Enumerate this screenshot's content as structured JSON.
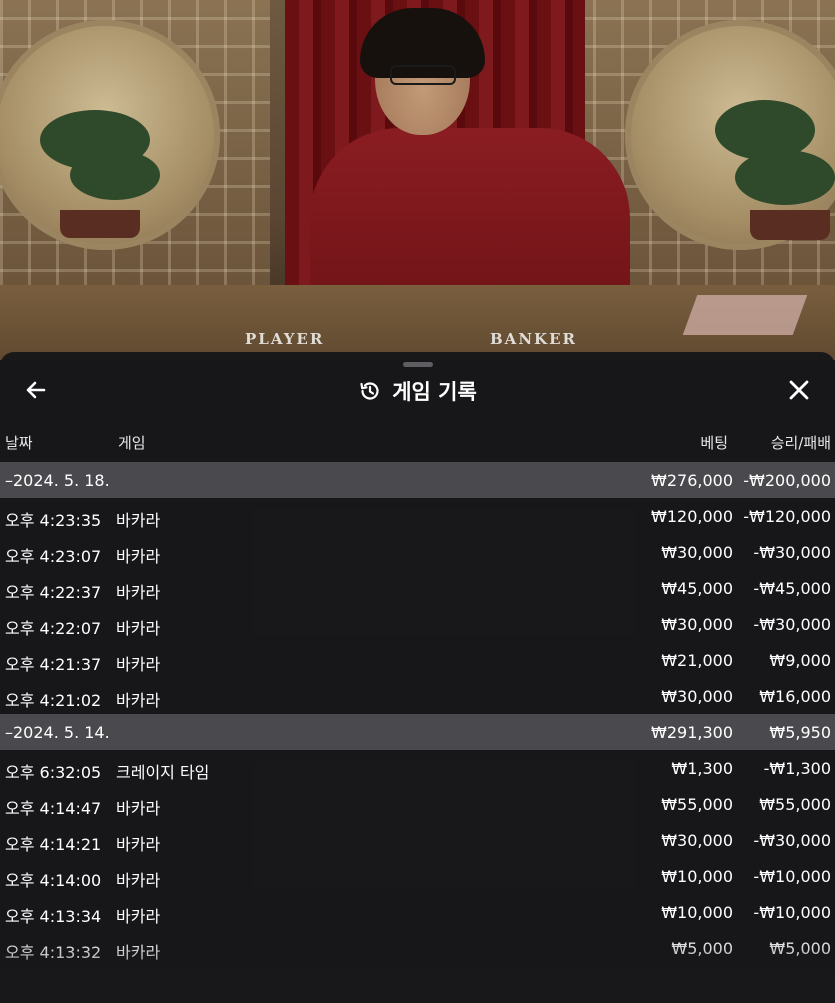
{
  "table": {
    "player_label": "PLAYER",
    "banker_label": "BANKER"
  },
  "sheet": {
    "title": "게임 기록",
    "icons": {
      "back": "arrow-left-icon",
      "history": "history-icon",
      "close": "close-icon"
    }
  },
  "columns": {
    "date": "날짜",
    "game": "게임",
    "bet": "베팅",
    "result": "승리/패배"
  },
  "groups": [
    {
      "date": "–2024. 5. 18.",
      "bet_total": "₩276,000",
      "result_total": "-₩200,000",
      "rows": [
        {
          "time": "오후 4:23:35",
          "game": "바카라",
          "bet": "₩120,000",
          "result": "-₩120,000"
        },
        {
          "time": "오후 4:23:07",
          "game": "바카라",
          "bet": "₩30,000",
          "result": "-₩30,000"
        },
        {
          "time": "오후 4:22:37",
          "game": "바카라",
          "bet": "₩45,000",
          "result": "-₩45,000"
        },
        {
          "time": "오후 4:22:07",
          "game": "바카라",
          "bet": "₩30,000",
          "result": "-₩30,000"
        },
        {
          "time": "오후 4:21:37",
          "game": "바카라",
          "bet": "₩21,000",
          "result": "₩9,000"
        },
        {
          "time": "오후 4:21:02",
          "game": "바카라",
          "bet": "₩30,000",
          "result": "₩16,000"
        }
      ]
    },
    {
      "date": "–2024. 5. 14.",
      "bet_total": "₩291,300",
      "result_total": "₩5,950",
      "rows": [
        {
          "time": "오후 6:32:05",
          "game": "크레이지 타임",
          "bet": "₩1,300",
          "result": "-₩1,300"
        },
        {
          "time": "오후 4:14:47",
          "game": "바카라",
          "bet": "₩55,000",
          "result": "₩55,000"
        },
        {
          "time": "오후 4:14:21",
          "game": "바카라",
          "bet": "₩30,000",
          "result": "-₩30,000"
        },
        {
          "time": "오후 4:14:00",
          "game": "바카라",
          "bet": "₩10,000",
          "result": "-₩10,000"
        },
        {
          "time": "오후 4:13:34",
          "game": "바카라",
          "bet": "₩10,000",
          "result": "-₩10,000"
        },
        {
          "time": "오후 4:13:32",
          "game": "바카라",
          "bet": "₩5,000",
          "result": "₩5,000"
        }
      ]
    }
  ]
}
